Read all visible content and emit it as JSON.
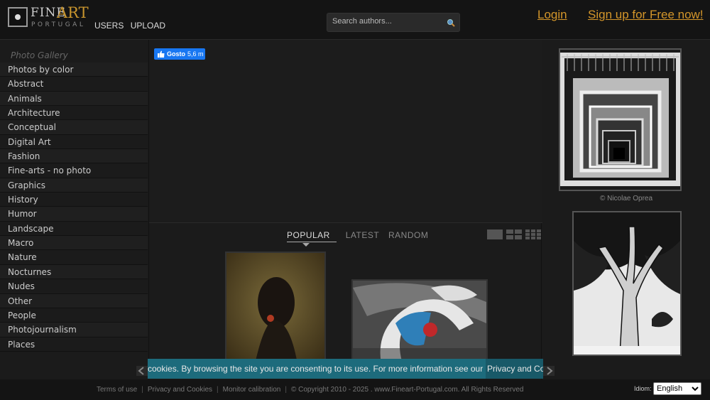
{
  "brand": {
    "fine": "FINE",
    "art": "ART",
    "portugal": "PORTUGAL"
  },
  "topnav": {
    "users": "USERS",
    "upload": "UPLOAD"
  },
  "search": {
    "placeholder": "Search authors..."
  },
  "account": {
    "login": "Login",
    "signup": "Sign up for Free now!"
  },
  "sidebar": {
    "heading": "Photo Gallery",
    "items": [
      {
        "label": "Photos by color"
      },
      {
        "label": "Abstract"
      },
      {
        "label": "Animals"
      },
      {
        "label": "Architecture"
      },
      {
        "label": "Conceptual"
      },
      {
        "label": "Digital Art"
      },
      {
        "label": "Fashion"
      },
      {
        "label": "Fine-arts - no photo"
      },
      {
        "label": "Graphics"
      },
      {
        "label": "History"
      },
      {
        "label": "Humor"
      },
      {
        "label": "Landscape"
      },
      {
        "label": "Macro"
      },
      {
        "label": "Nature"
      },
      {
        "label": "Nocturnes"
      },
      {
        "label": "Nudes"
      },
      {
        "label": "Other"
      },
      {
        "label": "People"
      },
      {
        "label": "Photojournalism"
      },
      {
        "label": "Places"
      }
    ]
  },
  "social": {
    "like_label": "Gosto",
    "like_count": "5,6 m"
  },
  "gallery": {
    "tabs": [
      {
        "label": "POPULAR"
      },
      {
        "label": "LATEST"
      },
      {
        "label": "RANDOM"
      }
    ]
  },
  "featured": {
    "credit": "© Nicolae Oprea"
  },
  "cookie": {
    "text": "cookies. By browsing the site you are consenting to its use. For more information see our",
    "link": "Privacy and Cookies"
  },
  "footer": {
    "terms": "Terms of use",
    "privacy": "Privacy and Cookies",
    "monitor": "Monitor calibration",
    "copyright": "© Copyright 2010 - 2025 . www.Fineart-Portugal.com. All Rights Reserved",
    "idiom_label": "Idiom:",
    "language": "English"
  },
  "colors": {
    "accent": "#d4962a",
    "cookie_bar": "#1d6b7c",
    "like_button": "#1877f2"
  }
}
